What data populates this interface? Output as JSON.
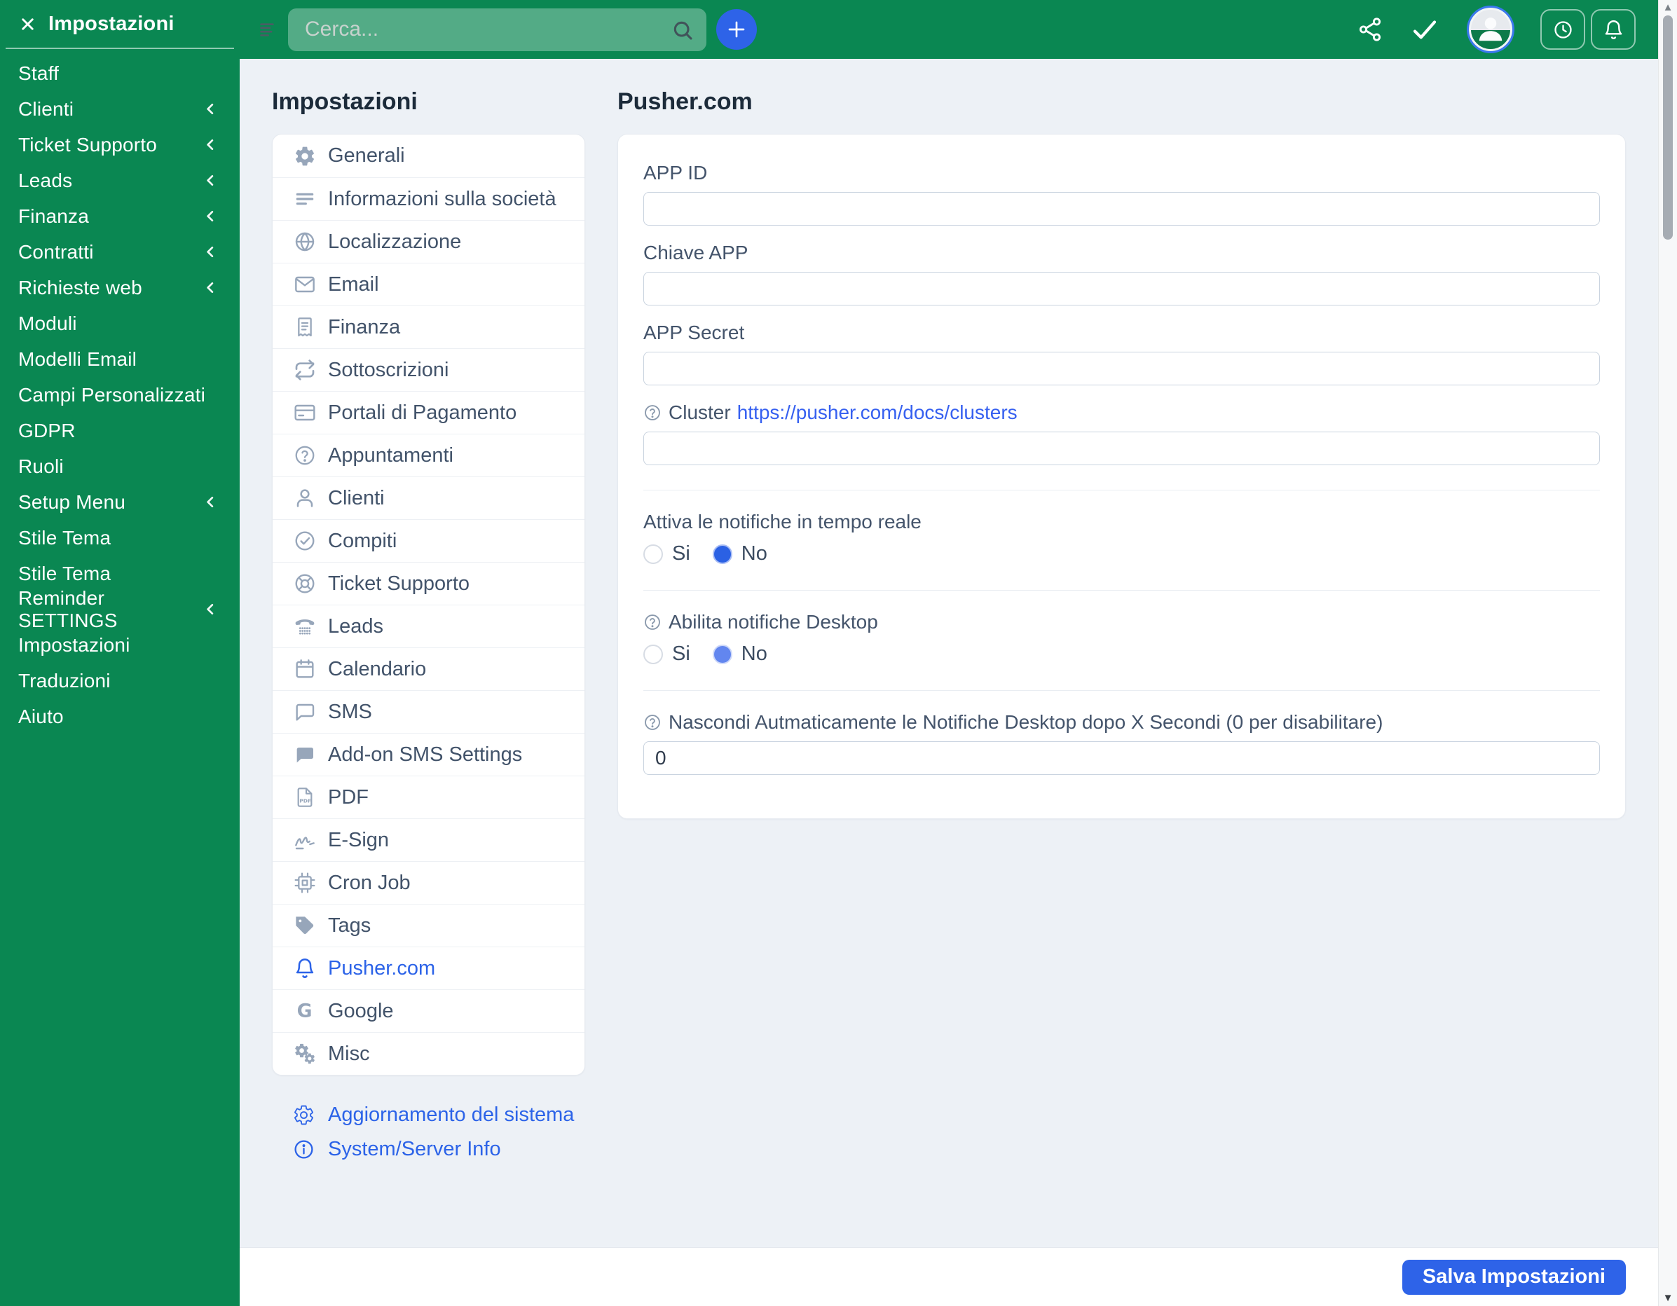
{
  "colors": {
    "brand_green": "#0a8752",
    "accent_blue": "#2e63e8",
    "link_blue": "#3660f0",
    "active_menu_blue": "#2c63e8"
  },
  "topbar": {
    "search": {
      "placeholder": "Cerca..."
    },
    "icons": [
      "menu-lines-icon",
      "search-icon",
      "plus-icon",
      "share-icon",
      "check-icon",
      "avatar",
      "clock-icon",
      "bell-icon"
    ]
  },
  "sidebar": {
    "header": {
      "label": "Impostazioni",
      "close_icon": "x-icon"
    },
    "items": [
      {
        "label": "Staff",
        "expandable": false
      },
      {
        "label": "Clienti",
        "expandable": true
      },
      {
        "label": "Ticket Supporto",
        "expandable": true
      },
      {
        "label": "Leads",
        "expandable": true
      },
      {
        "label": "Finanza",
        "expandable": true
      },
      {
        "label": "Contratti",
        "expandable": true
      },
      {
        "label": "Richieste web",
        "expandable": true
      },
      {
        "label": "Moduli",
        "expandable": false
      },
      {
        "label": "Modelli Email",
        "expandable": false
      },
      {
        "label": "Campi Personalizzati",
        "expandable": false
      },
      {
        "label": "GDPR",
        "expandable": false
      },
      {
        "label": "Ruoli",
        "expandable": false
      },
      {
        "label": "Setup Menu",
        "expandable": true
      },
      {
        "label": "Stile Tema",
        "expandable": false
      },
      {
        "label": "Stile Tema",
        "expandable": false
      },
      {
        "label": "Reminder SETTINGS",
        "expandable": true
      },
      {
        "label": "Impostazioni",
        "expandable": false
      },
      {
        "label": "Traduzioni",
        "expandable": false
      },
      {
        "label": "Aiuto",
        "expandable": false
      }
    ]
  },
  "settings_menu": {
    "title": "Impostazioni",
    "items": [
      {
        "label": "Generali",
        "icon": "gear-icon",
        "active": false
      },
      {
        "label": "Informazioni sulla società",
        "icon": "lines-icon",
        "active": false
      },
      {
        "label": "Localizzazione",
        "icon": "globe-icon",
        "active": false
      },
      {
        "label": "Email",
        "icon": "envelope-icon",
        "active": false
      },
      {
        "label": "Finanza",
        "icon": "receipt-icon",
        "active": false
      },
      {
        "label": "Sottoscrizioni",
        "icon": "repeat-icon",
        "active": false
      },
      {
        "label": "Portali di Pagamento",
        "icon": "credit-card-icon",
        "active": false
      },
      {
        "label": "Appuntamenti",
        "icon": "help-circle-icon",
        "active": false
      },
      {
        "label": "Clienti",
        "icon": "user-icon",
        "active": false
      },
      {
        "label": "Compiti",
        "icon": "check-circle-icon",
        "active": false
      },
      {
        "label": "Ticket Supporto",
        "icon": "life-ring-icon",
        "active": false
      },
      {
        "label": "Leads",
        "icon": "phone-icon",
        "active": false
      },
      {
        "label": "Calendario",
        "icon": "calendar-icon",
        "active": false
      },
      {
        "label": "SMS",
        "icon": "chat-outline-icon",
        "active": false
      },
      {
        "label": "Add-on SMS Settings",
        "icon": "chat-filled-icon",
        "active": false
      },
      {
        "label": "PDF",
        "icon": "pdf-icon",
        "active": false
      },
      {
        "label": "E-Sign",
        "icon": "signature-icon",
        "active": false
      },
      {
        "label": "Cron Job",
        "icon": "chip-icon",
        "active": false
      },
      {
        "label": "Tags",
        "icon": "tag-icon",
        "active": false
      },
      {
        "label": "Pusher.com",
        "icon": "bell-icon",
        "active": true
      },
      {
        "label": "Google",
        "icon": "google-icon",
        "active": false
      },
      {
        "label": "Misc",
        "icon": "gears-icon",
        "active": false
      }
    ],
    "links": [
      {
        "label": "Aggiornamento del sistema",
        "icon": "gear-outline-icon"
      },
      {
        "label": "System/Server Info",
        "icon": "info-circle-icon"
      }
    ]
  },
  "main": {
    "title": "Pusher.com",
    "fields": [
      {
        "label": "APP ID",
        "value": ""
      },
      {
        "label": "Chiave APP",
        "value": ""
      },
      {
        "label": "APP Secret",
        "value": ""
      },
      {
        "label": "Cluster",
        "link": "https://pusher.com/docs/clusters",
        "value": "",
        "help": true
      }
    ],
    "radio_groups": [
      {
        "label": "Attiva le notifiche in tempo reale",
        "help": false,
        "options": [
          "Si",
          "No"
        ],
        "selected": "No"
      },
      {
        "label": "Abilita notifiche Desktop",
        "help": true,
        "options": [
          "Si",
          "No"
        ],
        "selected": "No"
      }
    ],
    "number_field": {
      "label": "Nascondi Autmaticamente le Notifiche Desktop dopo X Secondi (0 per disabilitare)",
      "help": true,
      "value": "0"
    },
    "save_button": "Salva Impostazioni"
  }
}
